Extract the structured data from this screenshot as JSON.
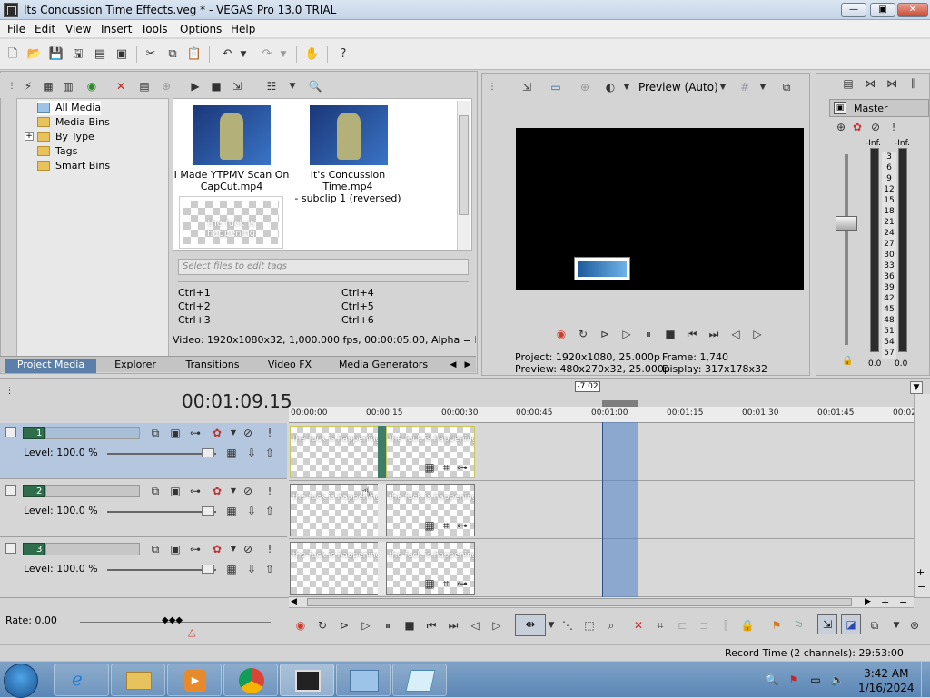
{
  "window": {
    "title": "Its Concussion Time Effects.veg * - VEGAS Pro 13.0 TRIAL",
    "minimize": "—",
    "maximize": "▣",
    "close": "✕"
  },
  "menu": [
    "File",
    "Edit",
    "View",
    "Insert",
    "Tools",
    "Options",
    "Help"
  ],
  "project_media": {
    "tree": [
      "All Media",
      "Media Bins",
      "By Type",
      "Tags",
      "Smart Bins"
    ],
    "tree_expander": "+",
    "thumbnails": [
      {
        "caption_line1": "I Made YTPMV Scan On",
        "caption_line2": "CapCut.mp4"
      },
      {
        "caption_line1": "It's Concussion Time.mp4",
        "caption_line2": "- subclip 1 (reversed)"
      }
    ],
    "text_media_label": "the fuck is happening",
    "tag_placeholder": "Select files to edit tags",
    "shortcuts": [
      "Ctrl+1",
      "Ctrl+2",
      "Ctrl+3",
      "Ctrl+4",
      "Ctrl+5",
      "Ctrl+6"
    ],
    "media_info": "Video: 1920x1080x32, 1,000.000 fps, 00:00:05.00, Alpha = Premult"
  },
  "tabs": [
    "Project Media",
    "Explorer",
    "Transitions",
    "Video FX",
    "Media Generators"
  ],
  "preview": {
    "mode": "Preview (Auto)",
    "project_label": "Project:",
    "project_value": "1920x1080, 25.000p",
    "preview_label": "Preview:",
    "preview_value": "480x270x32, 25.000p",
    "frame_label": "Frame:",
    "frame_value": "1,740",
    "display_label": "Display:",
    "display_value": "317x178x32"
  },
  "master": {
    "title": "Master",
    "left_peak": "-Inf.",
    "right_peak": "-Inf.",
    "scale": [
      "3",
      "6",
      "9",
      "12",
      "15",
      "18",
      "21",
      "24",
      "27",
      "30",
      "33",
      "36",
      "39",
      "42",
      "45",
      "48",
      "51",
      "54",
      "57"
    ],
    "left_value": "0.0",
    "right_value": "0.0"
  },
  "timeline": {
    "timecode": "00:01:09.15",
    "cursor_offset": "-7.02",
    "ruler": [
      "00:00:00",
      "00:00:15",
      "00:00:30",
      "00:00:45",
      "00:01:00",
      "00:01:15",
      "00:01:30",
      "00:01:45",
      "00:02"
    ],
    "tracks": [
      {
        "number": "1",
        "level": "Level: 100.0 %",
        "clips": [
          "the fuck is happening",
          "the fuck is happening"
        ]
      },
      {
        "number": "2",
        "level": "Level: 100.0 %",
        "clips": [
          "the fuck is happening",
          "the fuck is happening"
        ]
      },
      {
        "number": "3",
        "level": "Level: 100.0 %",
        "clips": [
          "the fuck is happening",
          "the fuck is happening"
        ]
      }
    ],
    "rate": "Rate: 0.00"
  },
  "status": {
    "record_time": "Record Time (2 channels): 29:53:00"
  },
  "taskbar": {
    "time": "3:42 AM",
    "date": "1/16/2024"
  },
  "colors": {
    "selection_blue": "#5c7faa",
    "track_green": "#2e6e4c",
    "record_red": "#d23a2a"
  }
}
